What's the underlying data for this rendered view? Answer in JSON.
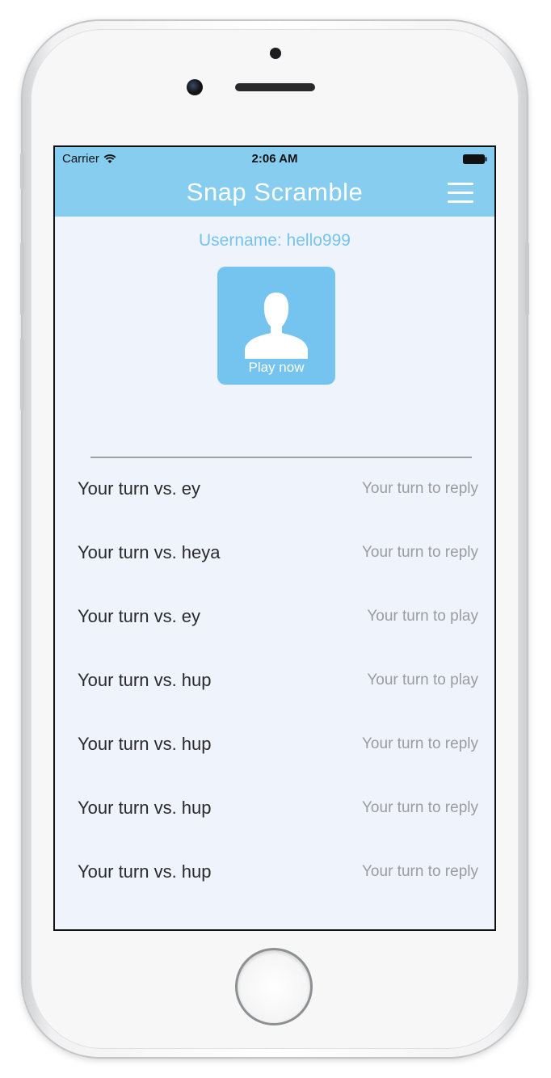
{
  "status_bar": {
    "carrier": "Carrier",
    "time": "2:06 AM"
  },
  "nav": {
    "title": "Snap Scramble"
  },
  "profile": {
    "username_text": "Username: hello999",
    "play_label": "Play now"
  },
  "games": [
    {
      "title": "Your turn vs. ey",
      "status": "Your turn to reply"
    },
    {
      "title": "Your turn vs. heya",
      "status": "Your turn to reply"
    },
    {
      "title": "Your turn vs. ey",
      "status": "Your turn to play"
    },
    {
      "title": "Your turn vs. hup",
      "status": "Your turn to play"
    },
    {
      "title": "Your turn vs. hup",
      "status": "Your turn to reply"
    },
    {
      "title": "Your turn vs. hup",
      "status": "Your turn to reply"
    },
    {
      "title": "Your turn vs. hup",
      "status": "Your turn to reply"
    }
  ],
  "colors": {
    "accent": "#87cdf0",
    "play_card": "#74c4ef",
    "username": "#75c4ee",
    "screen_bg": "#eff3fb"
  }
}
